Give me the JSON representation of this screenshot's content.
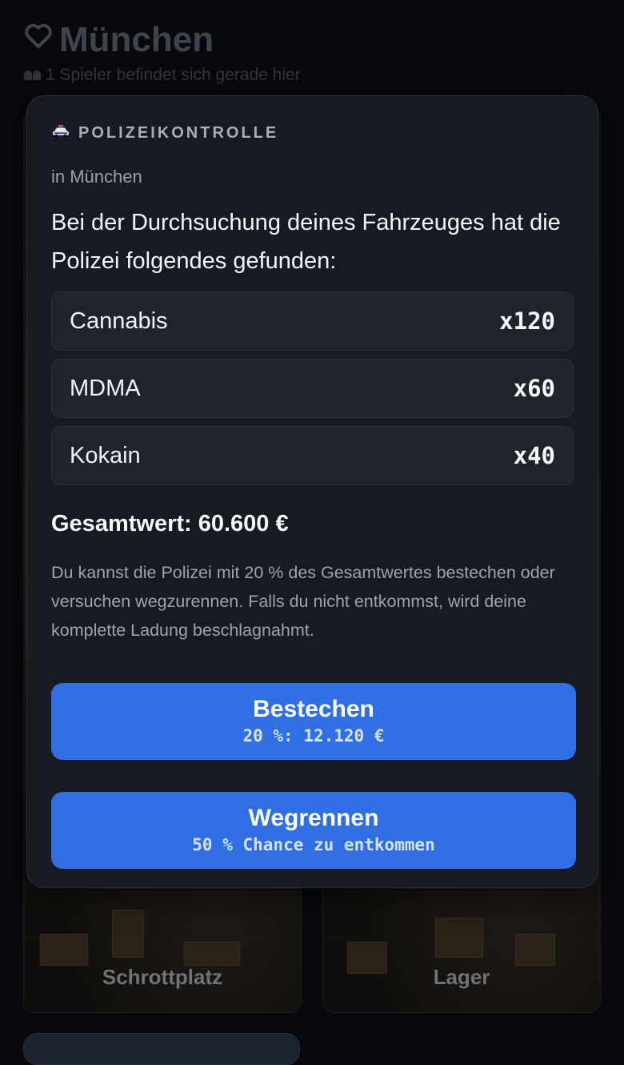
{
  "page": {
    "title": "München",
    "players_text": "1 Spieler befindet sich gerade hier"
  },
  "tiles": [
    {
      "label": "Schrottplatz"
    },
    {
      "label": "Lager"
    }
  ],
  "modal": {
    "kicker": "POLIZEIKONTROLLE",
    "location": "in München",
    "headline": "Bei der Durchsuchung deines Fahrzeuges hat die Polizei folgendes gefunden:",
    "items": [
      {
        "name": "Cannabis",
        "qty": "x120"
      },
      {
        "name": "MDMA",
        "qty": "x60"
      },
      {
        "name": "Kokain",
        "qty": "x40"
      }
    ],
    "total": "Gesamtwert: 60.600 €",
    "explanation": "Du kannst die Polizei mit 20 % des Gesamtwertes bestechen oder versuchen wegzurennen. Falls du nicht entkommst, wird deine komplette Ladung beschlagnahmt.",
    "bribe_button": {
      "label": "Bestechen",
      "sub": "20 %: 12.120 €"
    },
    "run_button": {
      "label": "Wegrennen",
      "sub": "50 % Chance zu entkommen"
    }
  },
  "colors": {
    "background": "#07090d",
    "modal": "#171a21",
    "item_row": "#1f232c",
    "primary_button": "#2f6fe3"
  },
  "icons": {
    "favorite": "heart-icon",
    "players": "people-icon",
    "kicker": "police-car-icon"
  }
}
